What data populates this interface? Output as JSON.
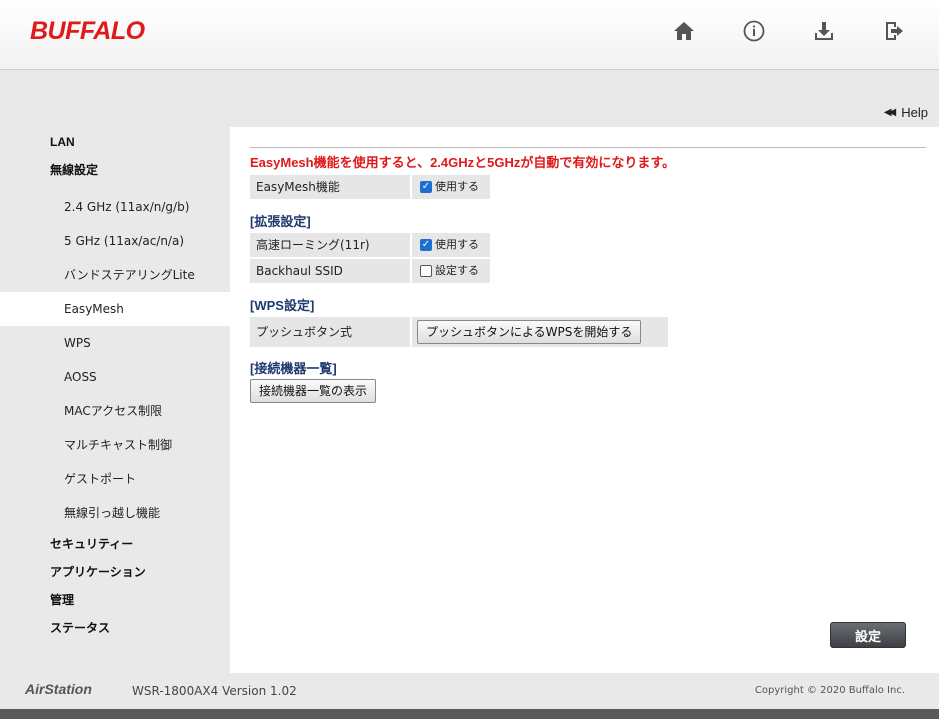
{
  "header": {
    "logo": "BUFFALO",
    "icons": [
      "home-icon",
      "info-icon",
      "download-icon",
      "logout-icon"
    ]
  },
  "help": {
    "label": "Help"
  },
  "sidebar": {
    "lan": "LAN",
    "wireless": "無線設定",
    "wireless_items": [
      "2.4 GHz (11ax/n/g/b)",
      "5 GHz (11ax/ac/n/a)",
      "バンドステアリングLite",
      "EasyMesh",
      "WPS",
      "AOSS",
      "MACアクセス制限",
      "マルチキャスト制御",
      "ゲストポート",
      "無線引っ越し機能"
    ],
    "security": "セキュリティー",
    "application": "アプリケーション",
    "admin": "管理",
    "status": "ステータス"
  },
  "content": {
    "notice": "EasyMesh機能を使用すると、2.4GHzと5GHzが自動で有効になります。",
    "easymesh_label": "EasyMesh機能",
    "easymesh_value": "使用する",
    "ext_section": "[拡張設定]",
    "roaming_label": "高速ローミング(11r)",
    "roaming_value": "使用する",
    "backhaul_label": "Backhaul SSID",
    "backhaul_value": "設定する",
    "wps_section": "[WPS設定]",
    "push_label": "プッシュボタン式",
    "push_button": "プッシュボタンによるWPSを開始する",
    "devices_section": "[接続機器一覧]",
    "devices_button": "接続機器一覧の表示",
    "submit": "設定"
  },
  "footer": {
    "brand": "AirStation",
    "model": "WSR-1800AX4 Version 1.02",
    "copyright": "Copyright © 2020 Buffalo Inc."
  },
  "colors": {
    "accent_red": "#e0191a",
    "section_blue": "#1e3a6e",
    "checkbox_blue": "#1f6fd1"
  }
}
